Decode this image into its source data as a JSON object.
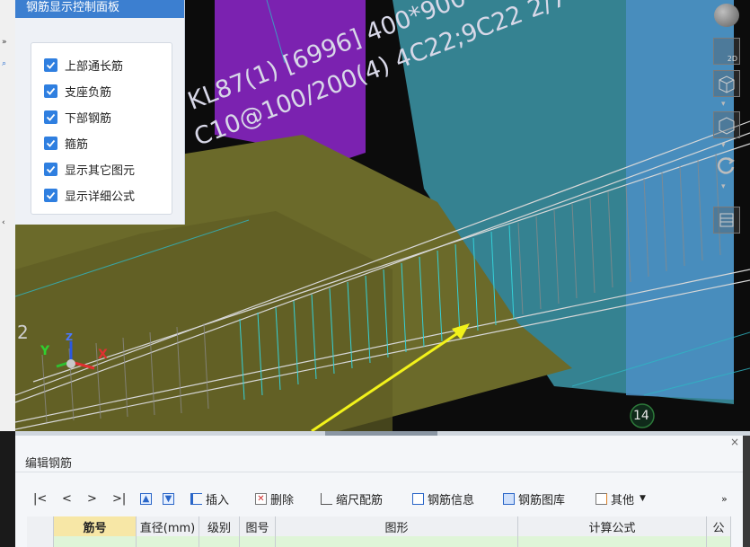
{
  "panel": {
    "title": "钢筋显示控制面板",
    "options": [
      {
        "label": "上部通长筋",
        "checked": true
      },
      {
        "label": "支座负筋",
        "checked": true
      },
      {
        "label": "下部钢筋",
        "checked": true
      },
      {
        "label": "箍筋",
        "checked": true
      },
      {
        "label": "显示其它图元",
        "checked": true
      },
      {
        "label": "显示详细公式",
        "checked": true
      }
    ]
  },
  "viewport": {
    "beam_label_line1": "KL87(1) [6996] 400*900",
    "beam_label_line2": "C10@100/200(4) 4C22;9C22 2/7",
    "axis_marker": "14",
    "grid_label": "2",
    "axis_x": "X",
    "axis_y": "Y",
    "axis_z": "Z",
    "view_2d_label": "2D"
  },
  "editor": {
    "title": "编辑钢筋",
    "close": "×",
    "nav": [
      "|<",
      "<",
      ">",
      ">|"
    ],
    "toolbar": {
      "insert": "插入",
      "delete": "删除",
      "scale_rebar": "缩尺配筋",
      "rebar_info": "钢筋信息",
      "rebar_library": "钢筋图库",
      "other": "其他",
      "more": "»"
    },
    "columns": [
      "筋号",
      "直径(mm)",
      "级别",
      "图号",
      "图形",
      "计算公式",
      "公"
    ]
  },
  "colors": {
    "panel_title_bg": "#3c7fd0",
    "checkbox": "#2f7fe0",
    "beam_olive": "#6b6a2a",
    "column_purple": "#7b22b0",
    "column_teal": "#3a8fa0",
    "stirrup_cyan": "#35d0d8",
    "arrow_yellow": "#f2f21a"
  }
}
